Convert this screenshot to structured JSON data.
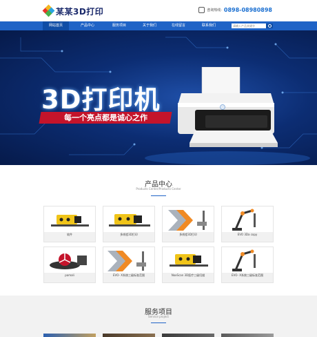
{
  "header": {
    "logo_text": "某某3D打印",
    "hotline_label": "咨询热线:",
    "hotline_number": "0898-08980898"
  },
  "nav": {
    "items": [
      {
        "label": "网站首页",
        "active": true
      },
      {
        "label": "产品中心",
        "active": false
      },
      {
        "label": "服务项目",
        "active": false
      },
      {
        "label": "关于我们",
        "active": false
      },
      {
        "label": "在线留言",
        "active": false
      },
      {
        "label": "联系我们",
        "active": false
      }
    ],
    "search_placeholder": "请输入产品关键字"
  },
  "banner": {
    "title": "3D打印机",
    "slogan": "每一个亮点都是诚心之作",
    "slide_count": 2
  },
  "products": {
    "title": "产品中心",
    "subtitle": "Products Center/Products Center",
    "items": [
      {
        "label": "软件",
        "img": "scanner-yellow"
      },
      {
        "label": "多线程3D打印",
        "img": "scanner-yellow"
      },
      {
        "label": "多线程3D打印",
        "img": "x-arm"
      },
      {
        "label": "EVO 3Da copy",
        "img": "robot-arm"
      },
      {
        "label": "pamali",
        "img": "fan-device"
      },
      {
        "label": "EVO- X系统三级标准范围",
        "img": "x-arm"
      },
      {
        "label": "NoxScan 3D医疗三级扫描",
        "img": "scanner-yellow"
      },
      {
        "label": "EVO- X系统三级标准范围",
        "img": "robot-arm"
      }
    ]
  },
  "services": {
    "title": "服务项目",
    "subtitle": "Service project"
  },
  "colors": {
    "nav_bg": "#1f63c6",
    "accent": "#1a6fd1",
    "slogan_bg": "#c4142b"
  }
}
